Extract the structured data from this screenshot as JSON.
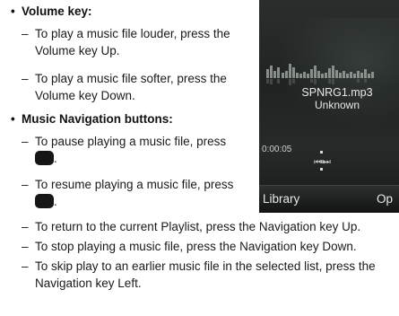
{
  "sections": [
    {
      "title": "Volume key",
      "suffix": ":",
      "items": [
        {
          "lines": [
            "To play a music file louder, press the",
            "Volume key Up."
          ]
        },
        {
          "lines": [
            "To play a music file softer, press the",
            "Volume key Down."
          ]
        }
      ]
    },
    {
      "title": "Music Navigation buttons",
      "suffix": ":",
      "items": [
        {
          "lines": [
            "To pause playing a music file, press"
          ],
          "trailing": "."
        },
        {
          "lines": [
            "To resume playing a music file, press"
          ],
          "trailing": "."
        },
        {
          "lines": [
            "To return to the current Playlist, press the Navigation key Up."
          ]
        },
        {
          "lines": [
            "To stop playing a music file, press the Navigation key Down."
          ]
        },
        {
          "lines": [
            "To skip play to an earlier music file in the selected list, press the",
            "Navigation key Left."
          ]
        }
      ]
    }
  ],
  "phone": {
    "filename": "SPNRG1.mp3",
    "artist": "Unknown",
    "elapsed": "0:00:05",
    "controls_glyph": "⏮⏸⏭",
    "left_softkey": "Library",
    "right_softkey": "Op"
  },
  "colors": {
    "key_square": "#161616",
    "screen_bg": "#1f2321"
  }
}
